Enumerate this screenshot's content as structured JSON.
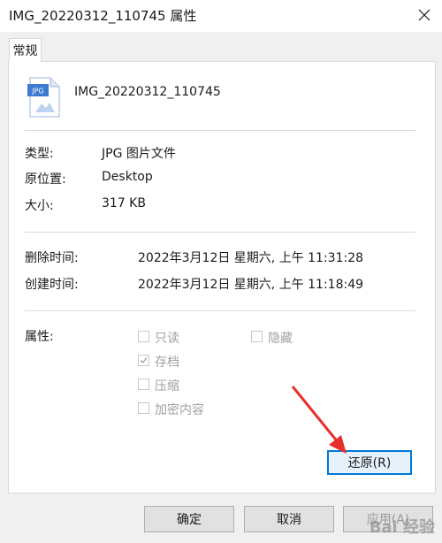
{
  "window": {
    "title": "IMG_20220312_110745 属性"
  },
  "tabs": [
    {
      "label": "常规",
      "active": true
    }
  ],
  "file": {
    "name": "IMG_20220312_110745",
    "icon": "jpg-file-icon",
    "icon_text": "JPG"
  },
  "details": {
    "type_label": "类型:",
    "type_value": "JPG 图片文件",
    "location_label": "原位置:",
    "location_value": "Desktop",
    "size_label": "大小:",
    "size_value": "317 KB"
  },
  "times": {
    "deleted_label": "删除时间:",
    "deleted_value": "2022年3月12日 星期六, 上午 11:31:28",
    "created_label": "创建时间:",
    "created_value": "2022年3月12日 星期六, 上午 11:18:49"
  },
  "attributes": {
    "label": "属性:",
    "items": [
      {
        "label": "只读",
        "checked": false
      },
      {
        "label": "隐藏",
        "checked": false
      },
      {
        "label": "存档",
        "checked": true
      },
      {
        "label": "压缩",
        "checked": false
      },
      {
        "label": "加密内容",
        "checked": false
      }
    ]
  },
  "buttons": {
    "restore": "还原(R)",
    "ok": "确定",
    "cancel": "取消",
    "apply": "应用(A)"
  },
  "watermark": "Bai 经验",
  "colors": {
    "accent": "#0078d7",
    "arrow": "#e8302a",
    "dialog_face": "#f0f0f0"
  }
}
